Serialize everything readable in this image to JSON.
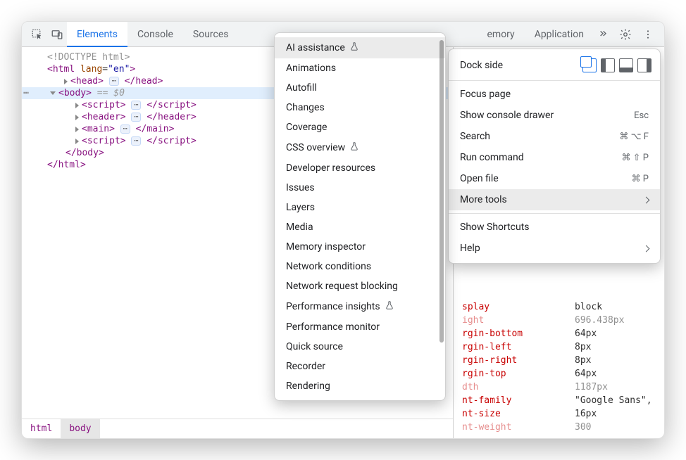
{
  "tabs": {
    "elements": "Elements",
    "console": "Console",
    "sources": "Sources",
    "memory_partial": "emory",
    "application": "Application"
  },
  "tree": {
    "doctype": "<!DOCTYPE html>",
    "html_open": "html",
    "lang_attr": "lang",
    "lang_val": "\"en\"",
    "head": "head",
    "body": "body",
    "eq0": "== $0",
    "script": "script",
    "header": "header",
    "main": "main",
    "html_close": "html"
  },
  "breadcrumb": {
    "b0": "html",
    "b1": "body"
  },
  "computed": [
    {
      "name": "splay",
      "val": "block",
      "grey": false
    },
    {
      "name": "ight",
      "val": "696.438px",
      "grey": true
    },
    {
      "name": "rgin-bottom",
      "val": "64px",
      "grey": false
    },
    {
      "name": "rgin-left",
      "val": "8px",
      "grey": false
    },
    {
      "name": "rgin-right",
      "val": "8px",
      "grey": false
    },
    {
      "name": "rgin-top",
      "val": "64px",
      "grey": false
    },
    {
      "name": "dth",
      "val": "1187px",
      "grey": true
    },
    {
      "name": "nt-family",
      "val": "\"Google Sans\",",
      "grey": false
    },
    {
      "name": "nt-size",
      "val": "16px",
      "grey": false
    },
    {
      "name": "nt-weight",
      "val": "300",
      "grey": true
    }
  ],
  "context_menu": {
    "dock_side": "Dock side",
    "focus_page": "Focus page",
    "show_console": "Show console drawer",
    "show_console_sc": "Esc",
    "search": "Search",
    "search_sc": "⌘ ⌥ F",
    "run_command": "Run command",
    "run_command_sc": "⌘ ⇧ P",
    "open_file": "Open file",
    "open_file_sc": "⌘ P",
    "more_tools": "More tools",
    "shortcuts": "Show Shortcuts",
    "help": "Help"
  },
  "submenu": [
    {
      "label": "AI assistance",
      "flask": true,
      "hover": true
    },
    {
      "label": "Animations"
    },
    {
      "label": "Autofill"
    },
    {
      "label": "Changes"
    },
    {
      "label": "Coverage"
    },
    {
      "label": "CSS overview",
      "flask": true
    },
    {
      "label": "Developer resources"
    },
    {
      "label": "Issues"
    },
    {
      "label": "Layers"
    },
    {
      "label": "Media"
    },
    {
      "label": "Memory inspector"
    },
    {
      "label": "Network conditions"
    },
    {
      "label": "Network request blocking"
    },
    {
      "label": "Performance insights",
      "flask": true
    },
    {
      "label": "Performance monitor"
    },
    {
      "label": "Quick source"
    },
    {
      "label": "Recorder"
    },
    {
      "label": "Rendering"
    }
  ]
}
